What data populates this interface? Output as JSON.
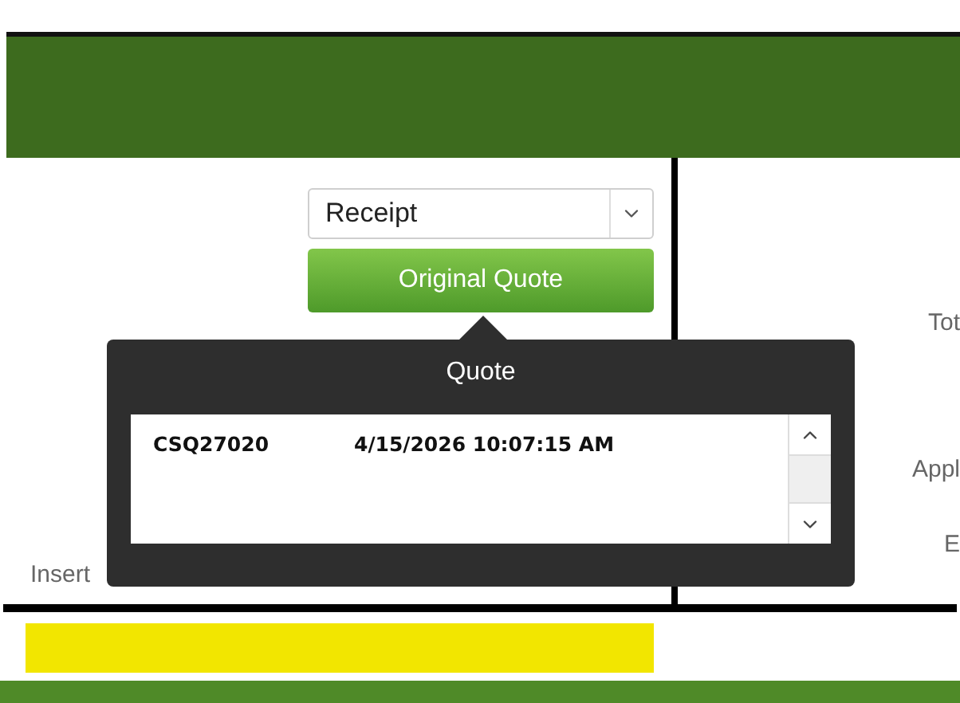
{
  "document_select": {
    "value": "Receipt"
  },
  "original_quote_button": {
    "label": "Original Quote"
  },
  "quote_popover": {
    "title": "Quote",
    "rows": [
      {
        "number": "CSQ27020",
        "date": "4/15/2026 10:07:15 AM"
      }
    ]
  },
  "left_labels": [
    "Insert"
  ],
  "right_labels": [
    "Tot",
    "Appl",
    "E"
  ]
}
